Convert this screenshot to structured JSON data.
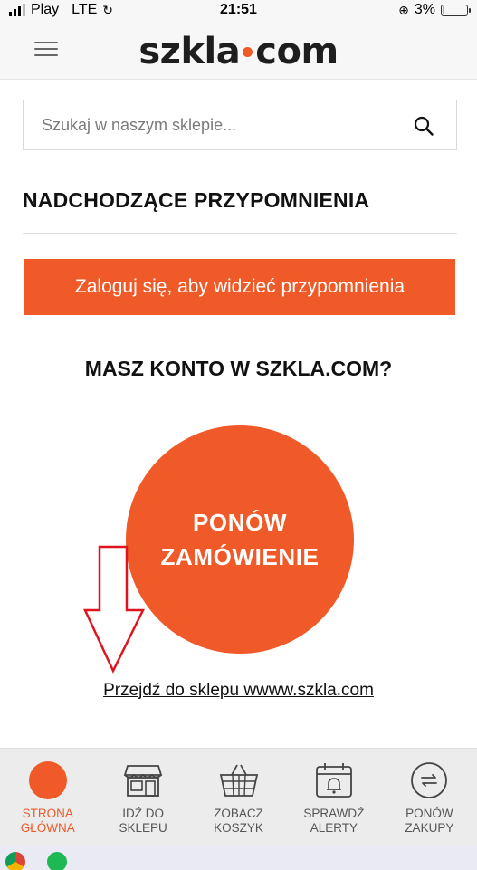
{
  "status_bar": {
    "carrier": "Play",
    "network": "LTE",
    "time": "21:51",
    "battery": "3%",
    "battery_level": 0.03
  },
  "header": {
    "logo_left": "szkla",
    "logo_right": "com",
    "menu_icon": "hamburger-icon"
  },
  "search": {
    "placeholder": "Szukaj w naszym sklepie...",
    "icon": "search-icon"
  },
  "reminders": {
    "title": "NADCHODZĄCE PRZYPOMNIENIA",
    "login_label": "Zaloguj się, aby widzieć przypomnienia"
  },
  "account": {
    "title": "MASZ KONTO W SZKLA.COM?"
  },
  "reorder": {
    "line1": "PONÓW",
    "line2": "ZAMÓWIENIE"
  },
  "shop_link": "Przejdź do sklepu wwww.szkla.com",
  "bottom_nav": [
    {
      "line1": "STRONA",
      "line2": "GŁÓWNA",
      "icon": "home-dot-icon",
      "active": true
    },
    {
      "line1": "IDŹ DO",
      "line2": "SKLEPU",
      "icon": "shop-icon",
      "active": false
    },
    {
      "line1": "ZOBACZ",
      "line2": "KOSZYK",
      "icon": "basket-icon",
      "active": false
    },
    {
      "line1": "SPRAWDŹ",
      "line2": "ALERTY",
      "icon": "calendar-bell-icon",
      "active": false
    },
    {
      "line1": "PONÓW",
      "line2": "ZAKUPY",
      "icon": "repeat-icon",
      "active": false
    }
  ],
  "colors": {
    "accent": "#ef5a28",
    "arrow": "#e0141e"
  }
}
